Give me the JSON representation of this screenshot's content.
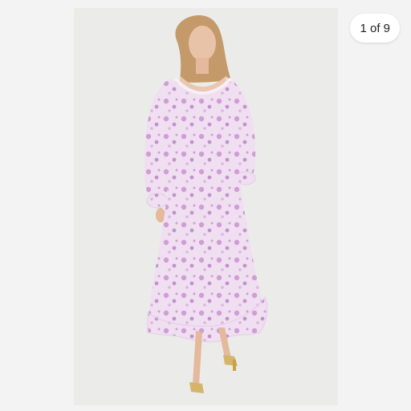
{
  "viewer": {
    "image_counter": "1 of 9",
    "photo": {
      "subject": "model-wearing-floral-maxi-dress"
    }
  },
  "colors": {
    "page_background": "#f3f3f3",
    "photo_background": "#ebebea",
    "badge_background": "#ffffff",
    "badge_text": "#222222",
    "dress_base": "#efdff0",
    "dress_print": "#c587cf"
  }
}
